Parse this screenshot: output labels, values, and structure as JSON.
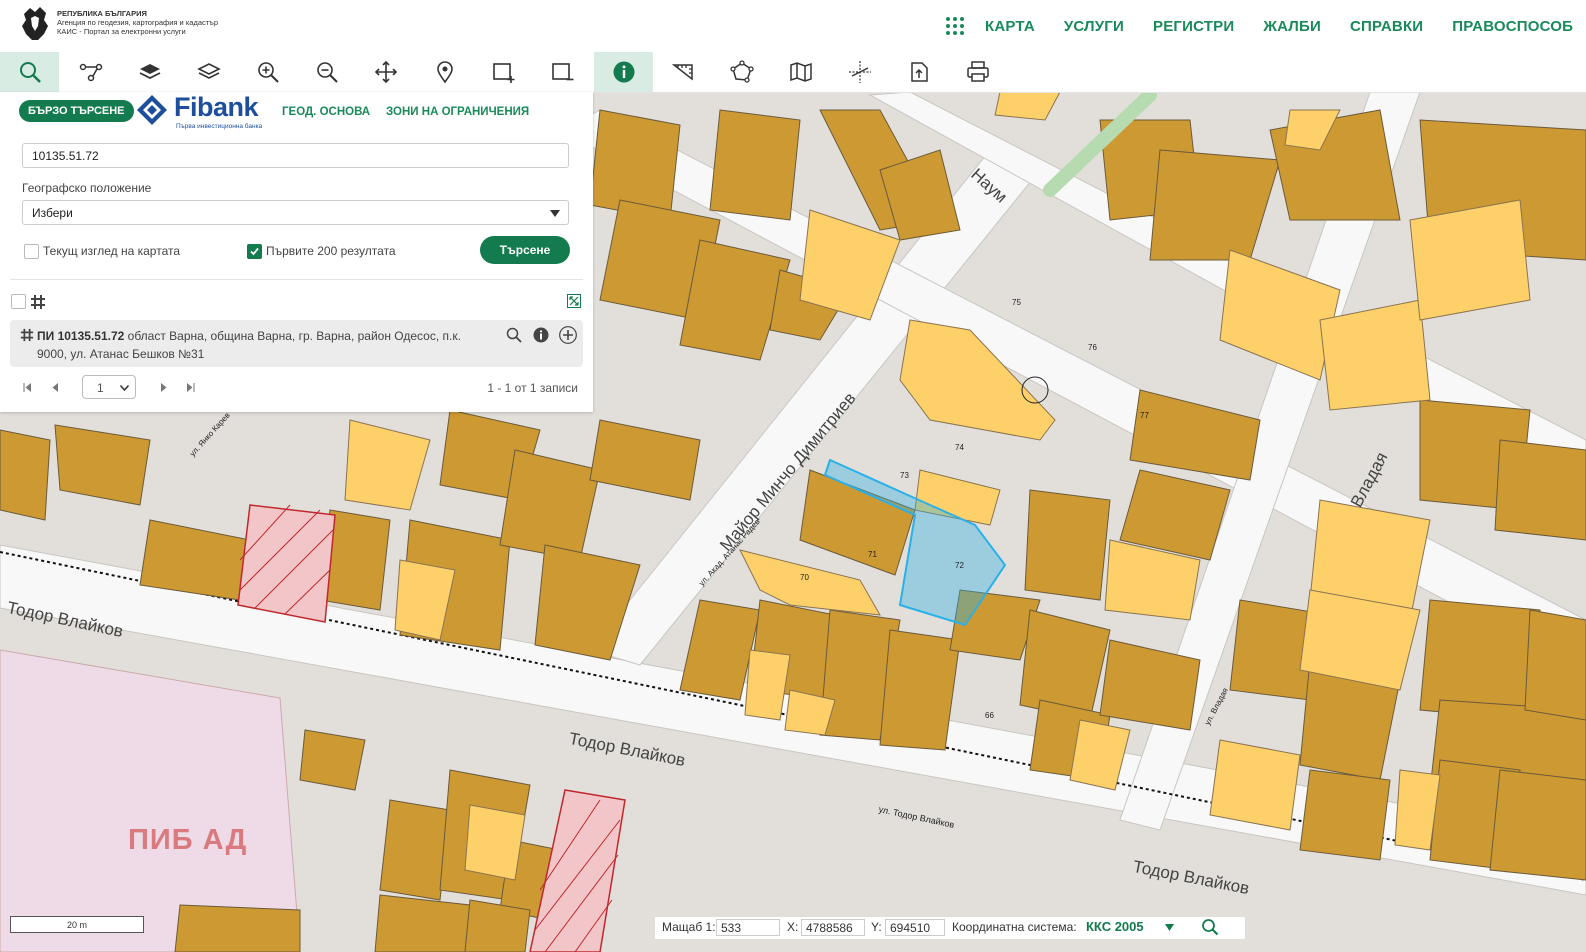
{
  "header": {
    "agency_line1": "РЕПУБЛИКА БЪЛГАРИЯ",
    "agency_line2": "Агенция по геодезия, картография и кадастър",
    "agency_line3": "КАИС - Портал за електронни услуги",
    "nav": [
      "КАРТА",
      "УСЛУГИ",
      "РЕГИСТРИ",
      "ЖАЛБИ",
      "СПРАВКИ",
      "ПРАВОСПОСОБ"
    ]
  },
  "panel": {
    "tab_quick": "БЪРЗО ТЪРСЕНЕ",
    "tab_geo": "ГЕОД. ОСНОВА",
    "tab_zones": "ЗОНИ НА ОГРАНИЧЕНИЯ",
    "sponsor_name": "Fibank",
    "sponsor_tagline": "Първа инвестиционна банка",
    "search_value": "10135.51.72",
    "geo_label": "Географско положение",
    "geo_select_value": "Избери",
    "check_current_view": "Текущ изглед на картата",
    "check_first200": "Първите 200 резултата",
    "search_button": "Търсене",
    "result_id": "ПИ 10135.51.72",
    "result_address": " област Варна, община Варна, гр. Варна, район Одесос, п.к. 9000, ул. Атанас Бешков №31",
    "page_value": "1",
    "records": "1 - 1 от 1 записи"
  },
  "map": {
    "streets": [
      "Наум",
      "Майор Минчо Димитриев",
      "Тодор Влайков",
      "Тодор Влайков",
      "Тодор Влайков",
      "Владая",
      "ул. Тодор Влайков",
      "ул. Акад. Атанас Радев",
      "ул. Владая",
      "ул. Янко Карев"
    ],
    "overlay_label": "ПИБ АД",
    "scale_label": "20 m",
    "colors": {
      "building": "#cc9933",
      "building_light": "#fdd06a",
      "road": "#f7f7f7",
      "block": "#e2dfda",
      "highlight": "#2ab0e8"
    }
  },
  "status": {
    "scale_label": "Мащаб 1:",
    "scale_value": "533",
    "x_label": "X:",
    "x_value": "4788586",
    "y_label": "Y:",
    "y_value": "694510",
    "crs_label": "Координатна система:",
    "crs_value": "ККС 2005"
  }
}
